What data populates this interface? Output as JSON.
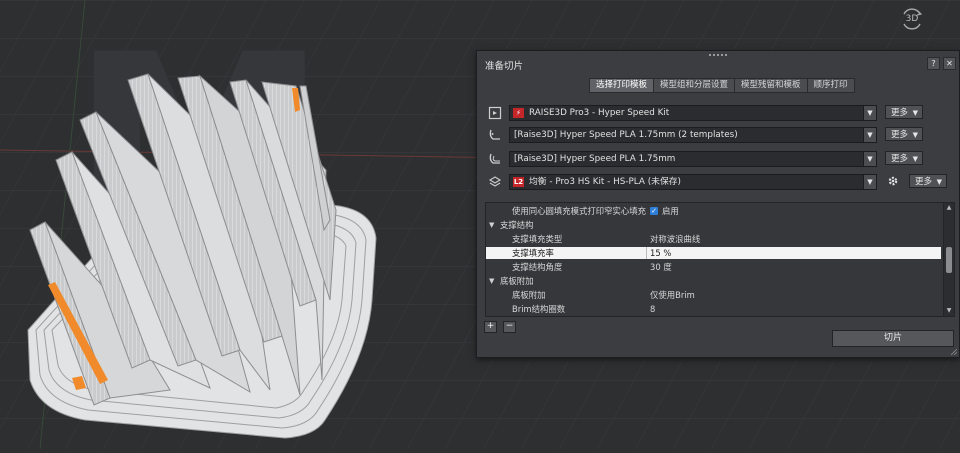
{
  "viewport": {
    "view_cube_label": "3D"
  },
  "dialog": {
    "title": "准备切片",
    "help_label": "?",
    "close_label": "✕",
    "tabs": [
      {
        "label": "选择打印模板",
        "active": true
      },
      {
        "label": "模型组和分层设置",
        "active": false
      },
      {
        "label": "模型残留和模板",
        "active": false
      },
      {
        "label": "顺序打印",
        "active": false
      }
    ],
    "selectors": {
      "printer": {
        "value": "RAISE3D Pro3 - Hyper Speed Kit",
        "more_label": "更多",
        "icon": "printer-icon"
      },
      "material_left": {
        "value": "[Raise3D] Hyper Speed PLA 1.75mm (2 templates)",
        "more_label": "更多",
        "icon": "left-extruder-icon"
      },
      "material_right": {
        "value": "[Raise3D] Hyper Speed PLA 1.75mm",
        "more_label": "更多",
        "icon": "right-extruder-icon"
      },
      "template": {
        "badge": "L2",
        "value": "均衡 - Pro3 HS Kit - HS-PLA (未保存)",
        "more_label": "更多",
        "icon": "layers-icon"
      }
    },
    "settings_tree": [
      {
        "type": "item",
        "label": "使用同心圆填充模式打印窄实心填充",
        "checked": true,
        "value": "启用"
      },
      {
        "type": "group",
        "label": "支撑结构"
      },
      {
        "type": "item",
        "label": "支撑填充类型",
        "value": "对称波浪曲线"
      },
      {
        "type": "item",
        "label": "支撑填充率",
        "value": "15 %",
        "selected": true
      },
      {
        "type": "item",
        "label": "支撑结构角度",
        "value": "30 度"
      },
      {
        "type": "group",
        "label": "底板附加"
      },
      {
        "type": "item",
        "label": "底板附加",
        "value": "仅使用Brim"
      },
      {
        "type": "item",
        "label": "Brim结构圈数",
        "value": "8"
      }
    ],
    "add_label": "+",
    "remove_label": "−",
    "slice_label": "切片"
  },
  "colors": {
    "background": "#2d2f31",
    "dialog": "#3b3d40",
    "accent_orange": "#f08a2a",
    "brand_red": "#c5262a",
    "check_blue": "#2f7fd9"
  }
}
